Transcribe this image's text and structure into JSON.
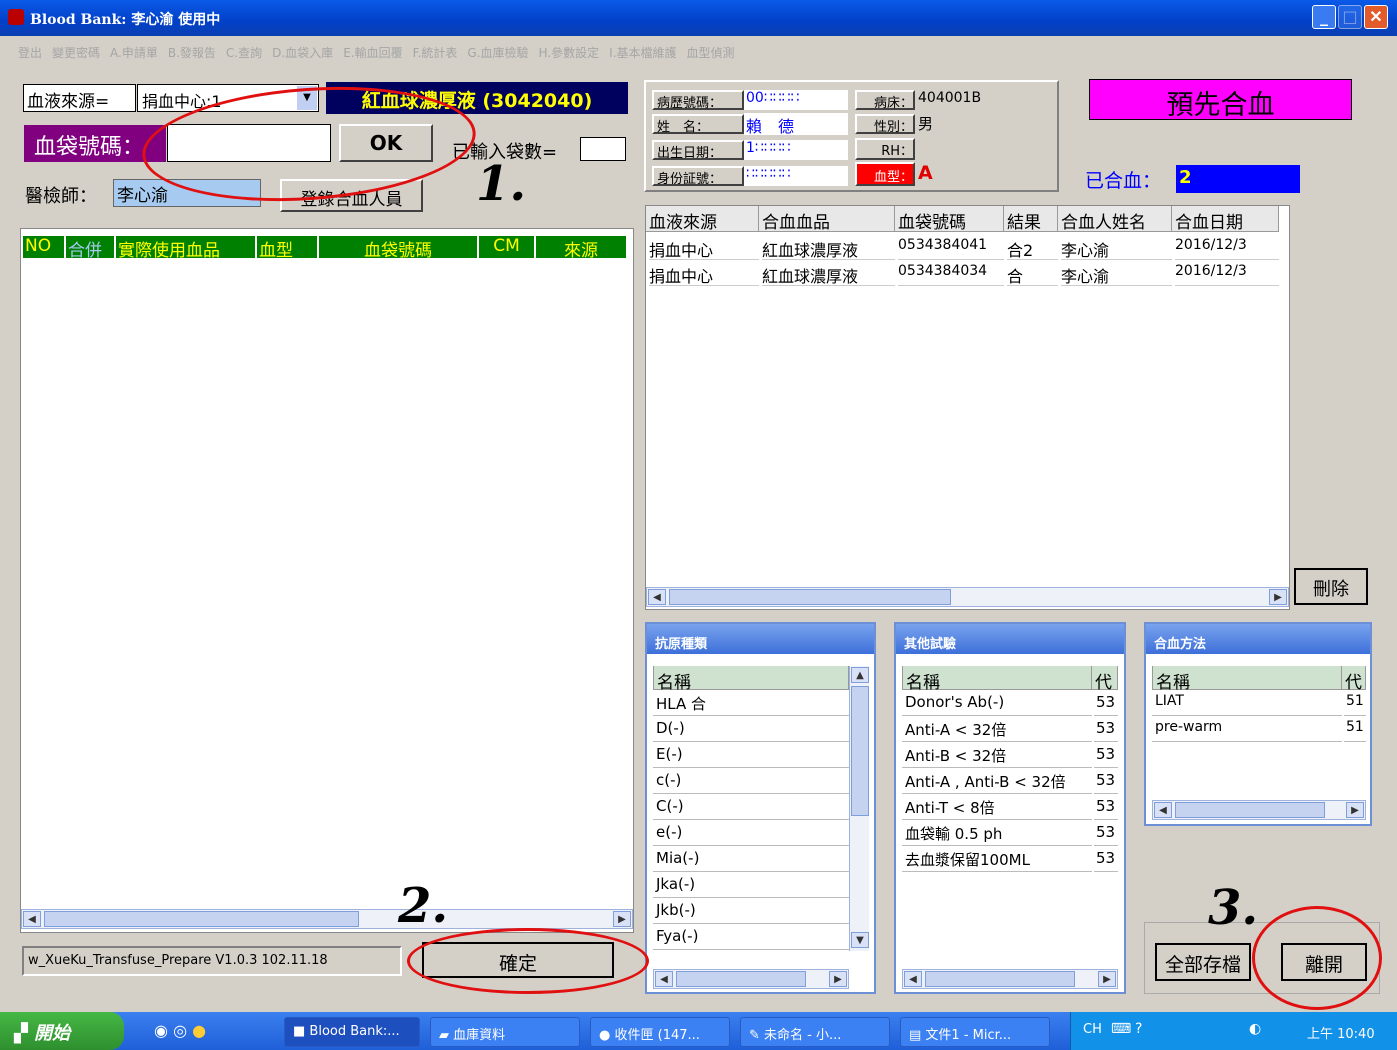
{
  "window": {
    "title": "Blood Bank: 李心渝 使用中"
  },
  "menu": [
    "登出",
    "變更密碼",
    "A.申請單",
    "B.發報告",
    "C.查詢",
    "D.血袋入庫",
    "E.輸血回覆",
    "F.統計表",
    "G.血庫檢驗",
    "H.參數設定",
    "I.基本檔維護",
    "血型偵測"
  ],
  "left": {
    "source_label": "血液來源=",
    "source_value": "捐血中心:1",
    "product_banner": "紅血球濃厚液 (3042040)",
    "bag_label": "血袋號碼：",
    "bag_value": "",
    "ok_label": "OK",
    "count_label": "已輸入袋數=",
    "count_value": "",
    "tech_label": "醫檢師：",
    "tech_value": "李心渝",
    "register_label": "登錄合血人員",
    "grid_headers": [
      "NO",
      "合併",
      "實際使用血品",
      "血型",
      "血袋號碼",
      "CM",
      "來源"
    ],
    "version": "w_XueKu_Transfuse_Prepare V1.0.3 102.11.18",
    "confirm_label": "確定"
  },
  "patient": {
    "chart_label": "病歷號碼：",
    "chart_value": "00∷∷∷∷",
    "bed_label": "病床：",
    "bed_value": "404001B",
    "name_label": "姓　名：",
    "name_value": "賴　德",
    "sex_label": "性別：",
    "sex_value": "男",
    "dob_label": "出生日期：",
    "dob_value": "1∷∷∷∷",
    "rh_label": "RH：",
    "rh_value": "",
    "id_label": "身份証號：",
    "id_value": "∷∷∷∷∷",
    "blood_label": "血型：",
    "blood_value": "A"
  },
  "status": {
    "pre_match": "預先合血",
    "matched_label": "已合血：",
    "matched_value": "2"
  },
  "match_table": {
    "headers": [
      "血液來源",
      "合血血品",
      "血袋號碼",
      "結果",
      "合血人姓名",
      "合血日期"
    ],
    "rows": [
      [
        "捐血中心",
        "紅血球濃厚液",
        "0534384041",
        "合2",
        "李心渝",
        "2016/12/3"
      ],
      [
        "捐血中心",
        "紅血球濃厚液",
        "0534384034",
        "合",
        "李心渝",
        "2016/12/3"
      ]
    ],
    "delete_label": "刪除"
  },
  "antigen": {
    "title": "抗原種類",
    "header": "名稱",
    "items": [
      "HLA 合",
      "D(-)",
      "E(-)",
      "c(-)",
      "C(-)",
      "e(-)",
      "Mia(-)",
      "Jka(-)",
      "Jkb(-)",
      "Fya(-)"
    ]
  },
  "other_tests": {
    "title": "其他試驗",
    "header": "名稱",
    "code_header": "代",
    "items": [
      {
        "name": "Donor's Ab(-)",
        "code": "53"
      },
      {
        "name": "Anti-A < 32倍",
        "code": "53"
      },
      {
        "name": "Anti-B < 32倍",
        "code": "53"
      },
      {
        "name": "Anti-A , Anti-B < 32倍",
        "code": "53"
      },
      {
        "name": "Anti-T < 8倍",
        "code": "53"
      },
      {
        "name": "血袋輸 0.5 ph",
        "code": "53"
      },
      {
        "name": "去血漿保留100ML",
        "code": "53"
      }
    ]
  },
  "methods": {
    "title": "合血方法",
    "header": "名稱",
    "code_header": "代",
    "items": [
      {
        "name": "LIAT",
        "code": "51"
      },
      {
        "name": "pre-warm",
        "code": "51"
      }
    ]
  },
  "actions": {
    "save_all": "全部存檔",
    "leave": "離開"
  },
  "annotations": [
    "1.",
    "2.",
    "3."
  ],
  "taskbar": {
    "start": "開始",
    "items": [
      "Blood Bank:...",
      "血庫資料",
      "收件匣 (147...",
      "未命名 - 小...",
      "文件1 - Micr..."
    ],
    "lang": "CH",
    "clock": "上午 10:40"
  },
  "colors": {
    "banner_bg": "#00005e",
    "banner_fg": "#ffff00",
    "pre_match_bg": "#ff00ff",
    "matched_bg": "#0000ff",
    "grid_header_bg": "#008000",
    "bag_label_bg": "#800080"
  }
}
